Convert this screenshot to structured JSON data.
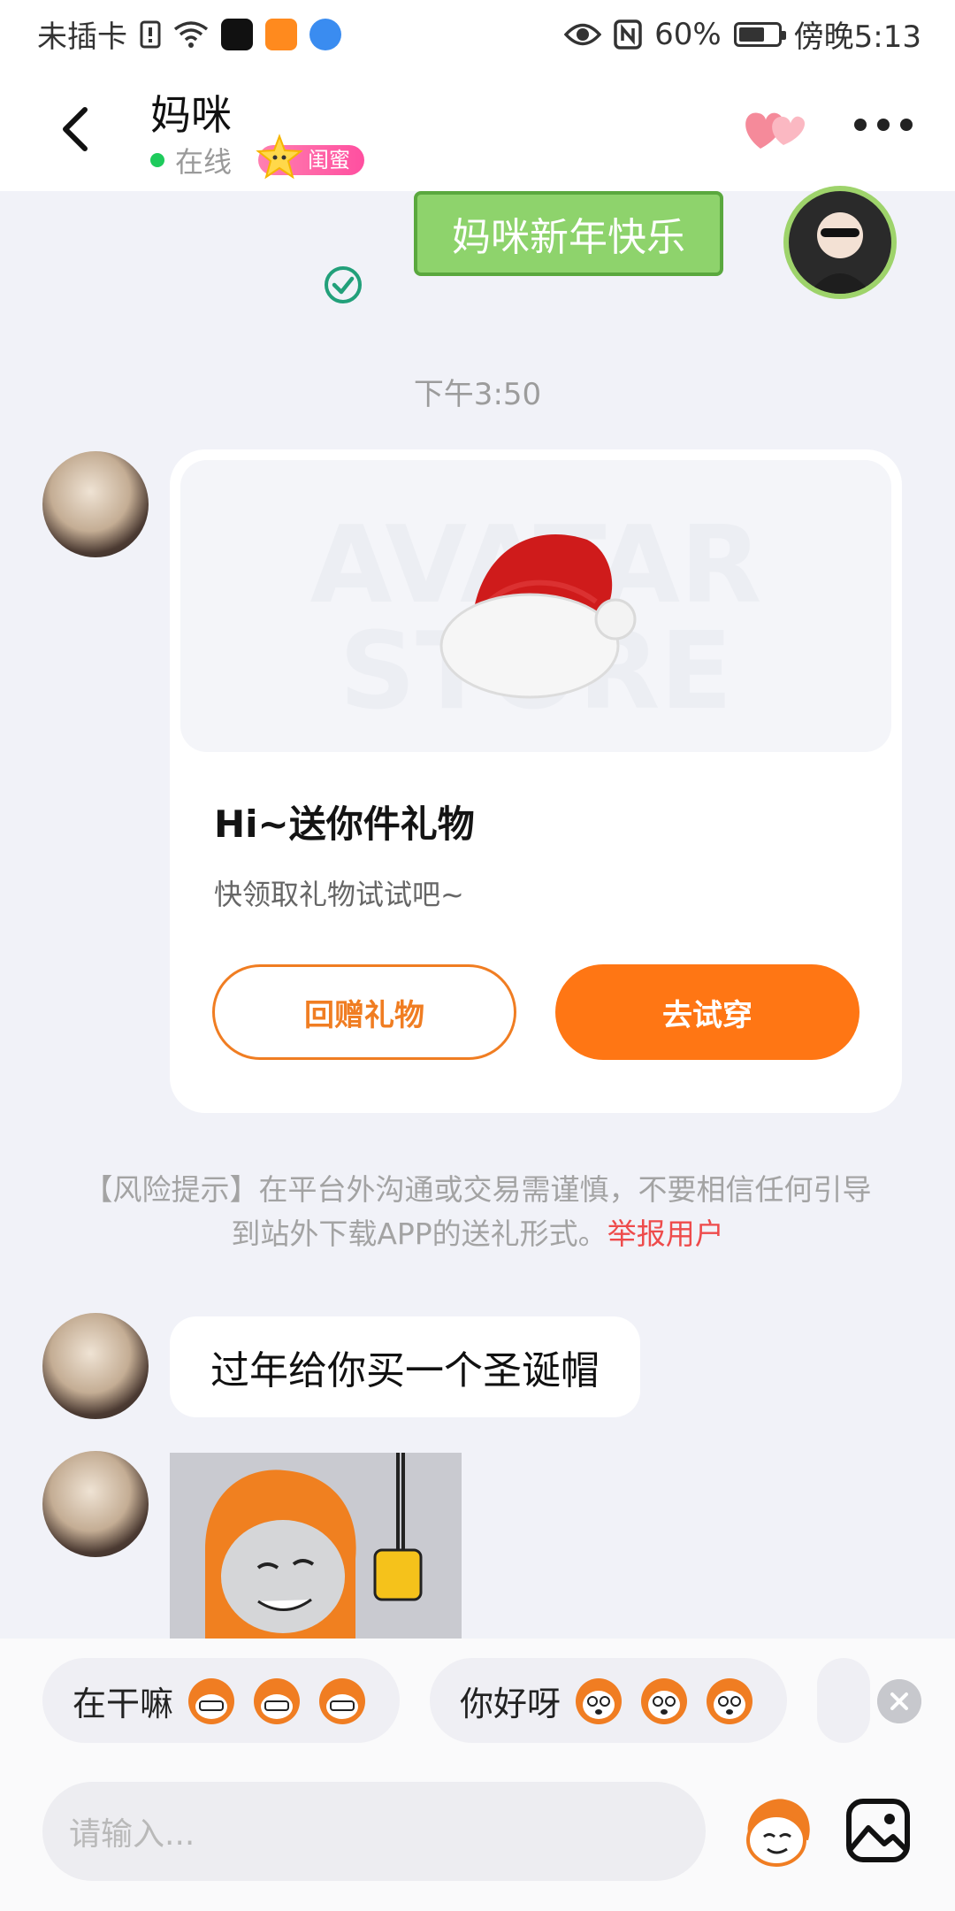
{
  "status_bar": {
    "carrier": "未插卡",
    "battery": "60%",
    "time": "傍晚5:13"
  },
  "header": {
    "title": "妈咪",
    "status": "在线",
    "badge": "闺蜜"
  },
  "messages": {
    "sent_sticker_text": "妈咪新年快乐",
    "time_separator": "下午3:50",
    "gift_card": {
      "watermark_line1": "AVATAR",
      "watermark_line2": "STORE",
      "title": "Hi~送你件礼物",
      "subtitle": "快领取礼物试试吧~",
      "return_gift_label": "回赠礼物",
      "try_on_label": "去试穿"
    },
    "risk_notice": {
      "text": "【风险提示】在平台外沟通或交易需谨慎，不要相信任何引导到站外下载APP的送礼形式。",
      "report_link": "举报用户"
    },
    "text_message": "过年给你买一个圣诞帽"
  },
  "quick_replies": [
    {
      "label": "在干嘛"
    },
    {
      "label": "你好呀"
    }
  ],
  "input": {
    "placeholder": "请输入..."
  },
  "colors": {
    "accent_orange": "#ff7614",
    "online_green": "#1ecb5c",
    "report_red": "#ee4b4b"
  },
  "icons": [
    "back-icon",
    "hearts-icon",
    "more-icon",
    "check-icon",
    "close-icon",
    "emoji-icon",
    "image-icon",
    "wifi-icon",
    "eye-icon",
    "nfc-icon",
    "battery-icon"
  ]
}
